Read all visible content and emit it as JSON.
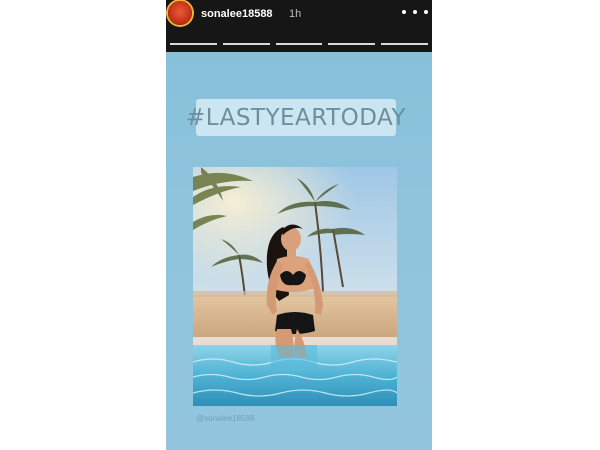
{
  "story": {
    "username": "sonalee18588",
    "time_ago": "1h",
    "more_icon": "more-horizontal-icon",
    "avatar_icon": "avatar",
    "progress_segments": 5,
    "hashtag_text": "#LASTYEARTODAY",
    "photo_alt": "Woman in black bikini sitting at the edge of a pool with palm trees",
    "photo_credit": "@sonalee18588"
  },
  "colors": {
    "story_background": "#8ec4dc",
    "topbar_background": "#161616",
    "hashtag_background": "#d7ecf5",
    "hashtag_text": "#6c8e9d"
  }
}
